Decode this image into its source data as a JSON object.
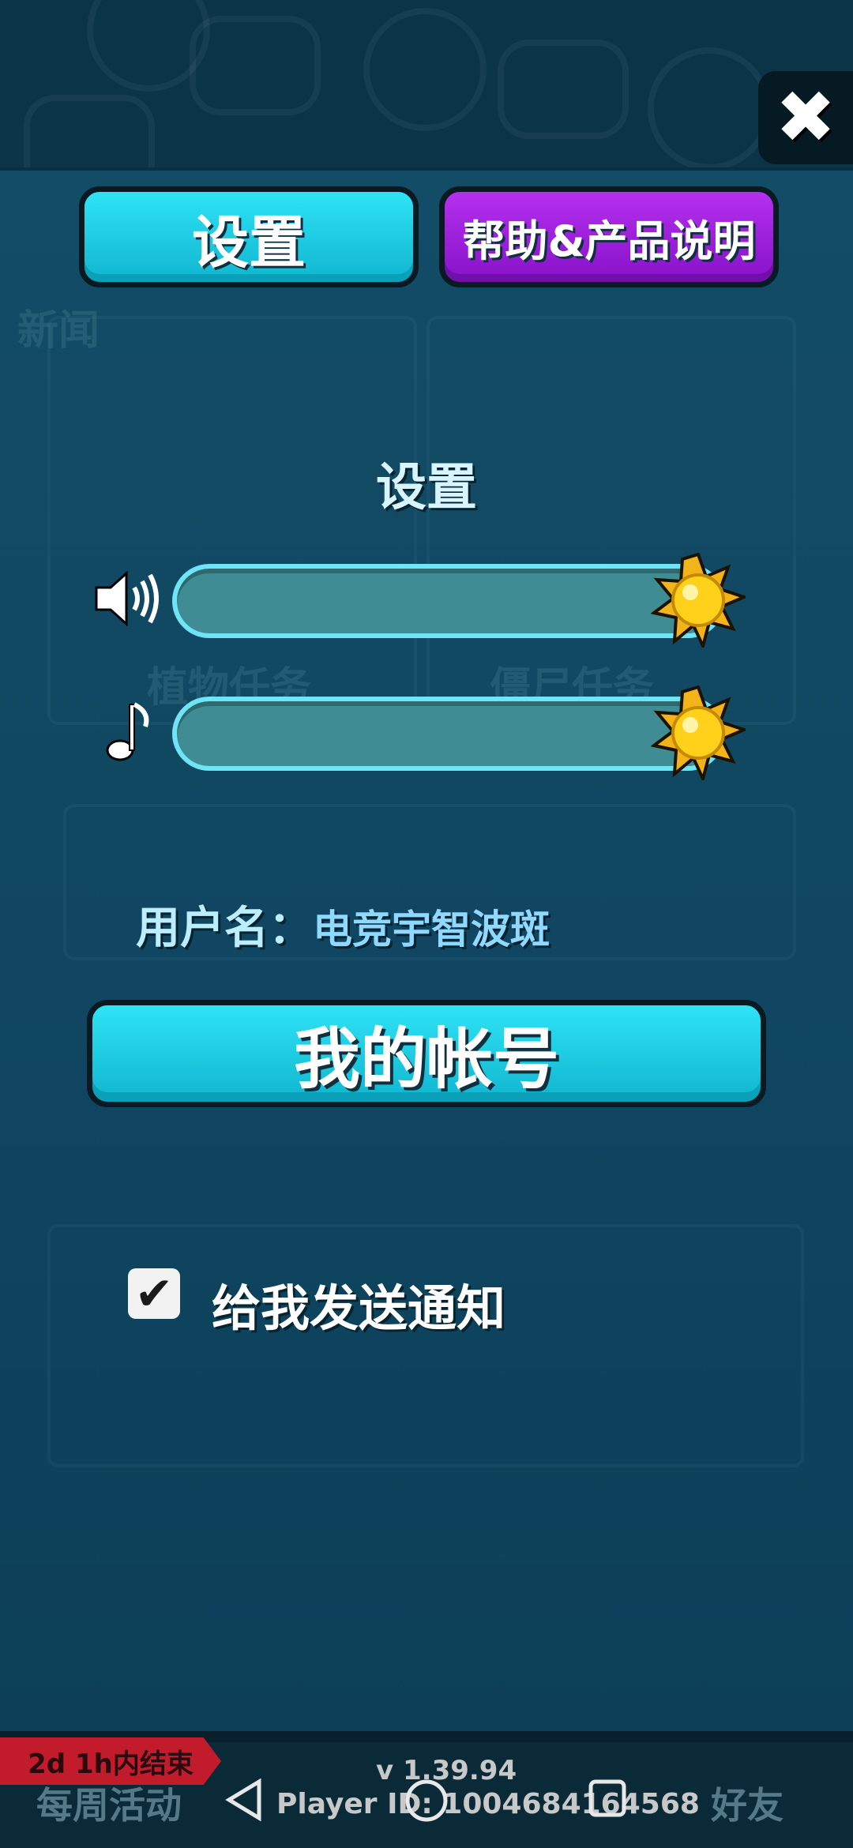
{
  "header": {
    "tab_settings": "设置",
    "tab_help": "帮助&产品说明",
    "close_icon": "close-icon"
  },
  "background": {
    "ghost_news": "新闻",
    "ghost_plant_task": "植物任务",
    "ghost_zombie_task": "僵尸任务"
  },
  "settings": {
    "title": "设置",
    "sound_icon": "speaker-icon",
    "music_icon": "music-note-icon",
    "sound_level": 1.0,
    "music_level": 1.0,
    "username_label": "用户名：",
    "username_value": "电竞宇智波斑",
    "account_button": "我的帐号",
    "notify_checked": true,
    "notify_label": "给我发送通知"
  },
  "bottom_bar": {
    "event_timer": "2d 1h内结束",
    "weekly_events": "每周活动",
    "friends": "好友",
    "version": "v 1.39.94",
    "player_id": "Player ID: 1004684164568"
  },
  "colors": {
    "accent_cyan": "#10b5cf",
    "accent_purple": "#8612c9",
    "panel_bg": "#0f4560",
    "slider_border": "#6ee4f4"
  }
}
